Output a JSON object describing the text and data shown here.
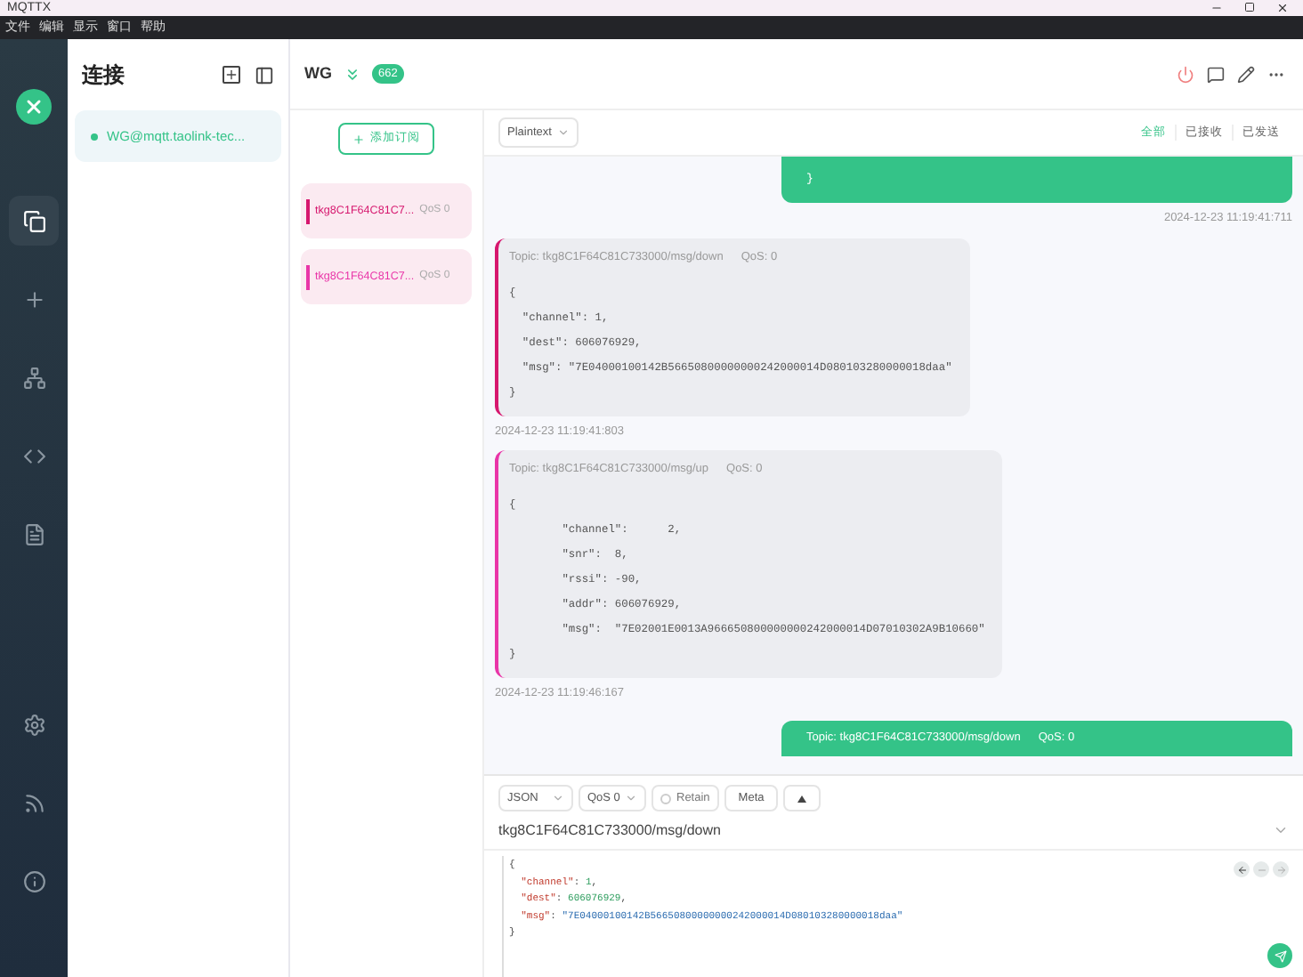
{
  "app": {
    "title": "MQTTX"
  },
  "menu": [
    "文件",
    "编辑",
    "显示",
    "窗口",
    "帮助"
  ],
  "nav": [
    {
      "kind": "connections",
      "selected": true
    },
    {
      "kind": "new",
      "selected": false
    },
    {
      "kind": "topology",
      "selected": false
    },
    {
      "kind": "script",
      "selected": false
    },
    {
      "kind": "log",
      "selected": false
    },
    {
      "kind": "settings",
      "selected": false
    },
    {
      "kind": "feed",
      "selected": false
    },
    {
      "kind": "about",
      "selected": false
    }
  ],
  "connections": {
    "title": "连接",
    "items": [
      {
        "name": "WG@mqtt.taolink-tec...",
        "selected": true,
        "online": true
      }
    ]
  },
  "header": {
    "name": "WG",
    "count": "662"
  },
  "subscriptions": {
    "add_label": "添加订阅",
    "items": [
      {
        "topic": "tkg8C1F64C81C7...",
        "qos": "QoS 0",
        "color": "#d6176e"
      },
      {
        "topic": "tkg8C1F64C81C7...",
        "qos": "QoS 0",
        "color": "#e935a8"
      }
    ]
  },
  "toolbar": {
    "format": "Plaintext",
    "filters": [
      {
        "label": "全部",
        "selected": true
      },
      {
        "label": "已接收",
        "selected": false
      },
      {
        "label": "已发送",
        "selected": false
      }
    ]
  },
  "messages": [
    {
      "kind": "sent",
      "payload": "}",
      "time": "2024-12-23 11:19:41:711"
    },
    {
      "kind": "received",
      "topic": "Topic: tkg8C1F64C81C733000/msg/down",
      "qos": "QoS: 0",
      "color": "#d6176e",
      "payload": "{\n  \"channel\": 1,\n  \"dest\": 606076929,\n  \"msg\": \"7E04000100142B56650800000000242000014D080103280000018daa\"\n}",
      "time": "2024-12-23 11:19:41:803"
    },
    {
      "kind": "received",
      "topic": "Topic: tkg8C1F64C81C733000/msg/up",
      "qos": "QoS: 0",
      "color": "#e935a8",
      "payload": "{\n        \"channel\":      2,\n        \"snr\":  8,\n        \"rssi\": -90,\n        \"addr\": 606076929,\n        \"msg\":  \"7E02001E0013A966650800000000242000014D07010302A9B10660\"\n}",
      "time": "2024-12-23 11:19:46:167"
    },
    {
      "kind": "sent",
      "topic": "Topic: tkg8C1F64C81C733000/msg/down",
      "qos": "QoS: 0"
    }
  ],
  "composer": {
    "format": "JSON",
    "qos": "QoS 0",
    "retain": {
      "label": "Retain",
      "checked": false
    },
    "meta": "Meta",
    "topic": "tkg8C1F64C81C733000/msg/down",
    "payload": "{\n  \"channel\": 1,\n  \"dest\": 606076929,\n  \"msg\": \"7E04000100142B56650800000000242000014D080103280000018daa\"\n}"
  }
}
